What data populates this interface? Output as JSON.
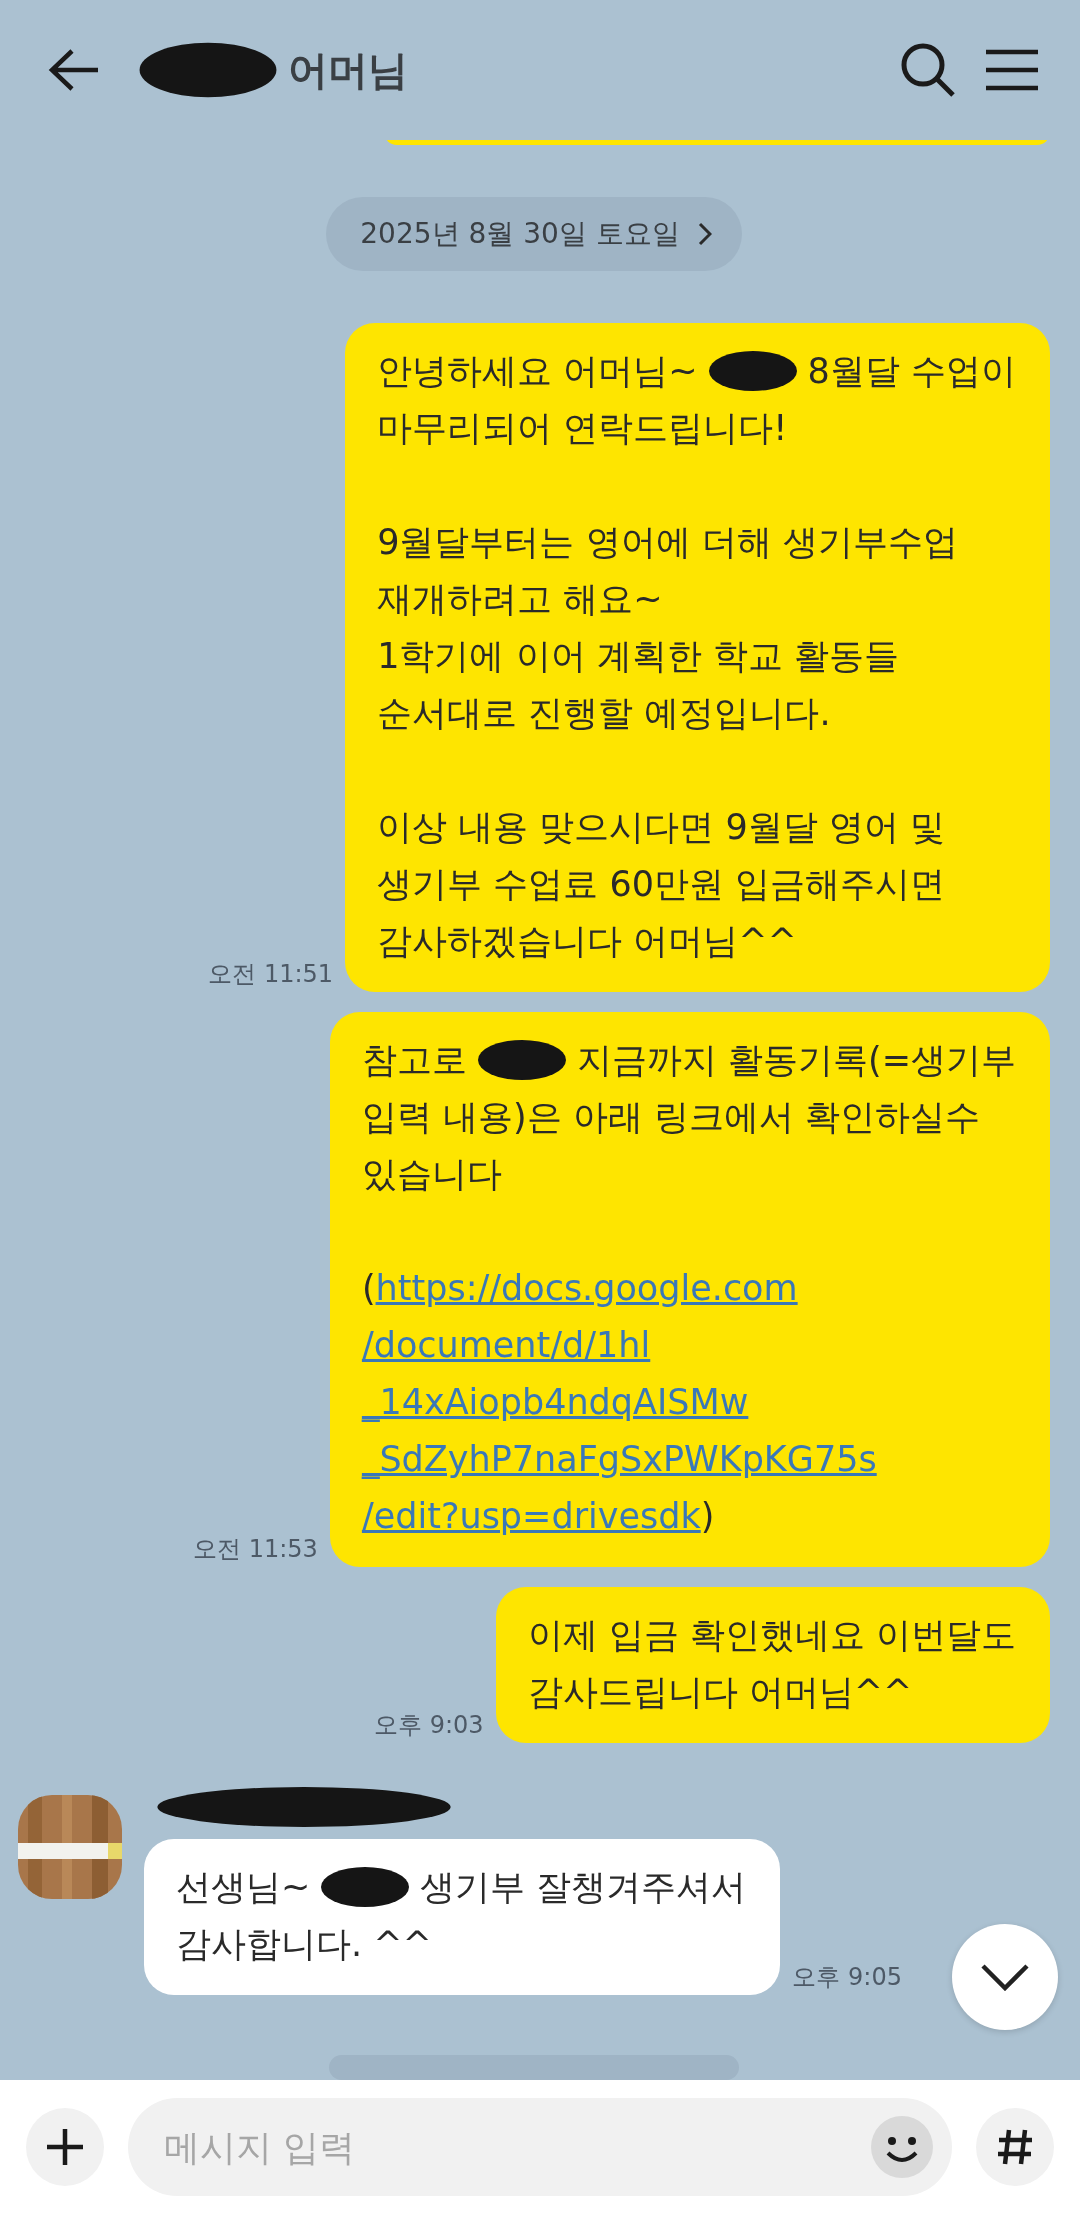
{
  "header": {
    "title": [
      {
        "kind": "redaction"
      },
      {
        "kind": "text",
        "text": "어머님"
      }
    ]
  },
  "date_divider": {
    "label": "2025년 8월 30일 토요일"
  },
  "messages": [
    {
      "kind": "sent",
      "time": "오전 11:51",
      "paragraphs": [
        [
          [
            {
              "kind": "text",
              "text": "안녕하세요 어머님~"
            },
            {
              "kind": "redaction"
            },
            {
              "kind": "text",
              "text": "8월달 수업이"
            }
          ],
          [
            {
              "kind": "text",
              "text": "마무리되어 연락드립니다!"
            }
          ]
        ],
        [
          [
            {
              "kind": "text",
              "text": "9월달부터는 영어에 더해 생기부수업"
            }
          ],
          [
            {
              "kind": "text",
              "text": "재개하려고 해요~"
            }
          ],
          [
            {
              "kind": "text",
              "text": "1학기에 이어 계획한 학교 활동들"
            }
          ],
          [
            {
              "kind": "text",
              "text": "순서대로 진행할 예정입니다."
            }
          ]
        ],
        [
          [
            {
              "kind": "text",
              "text": "이상 내용 맞으시다면 9월달 영어 및"
            }
          ],
          [
            {
              "kind": "text",
              "text": "생기부 수업료 60만원 입금해주시면"
            }
          ],
          [
            {
              "kind": "text",
              "text": "감사하겠습니다 어머님^^"
            }
          ]
        ]
      ]
    },
    {
      "kind": "sent",
      "time": "오전 11:53",
      "paragraphs": [
        [
          [
            {
              "kind": "text",
              "text": "참고로"
            },
            {
              "kind": "redaction"
            },
            {
              "kind": "text",
              "text": "지금까지 활동기록(=생기부"
            }
          ],
          [
            {
              "kind": "text",
              "text": "입력 내용)은 아래 링크에서 확인하실수"
            }
          ],
          [
            {
              "kind": "text",
              "text": "있습니다"
            }
          ]
        ],
        [
          [
            {
              "kind": "text",
              "text": "("
            },
            {
              "kind": "link",
              "text": "https://docs.google.com"
            }
          ],
          [
            {
              "kind": "link",
              "text": "/document/d/1hl"
            }
          ],
          [
            {
              "kind": "link",
              "text": "_14xAiopb4ndqAISMw"
            }
          ],
          [
            {
              "kind": "link",
              "text": "_SdZyhP7naFgSxPWKpKG75s"
            }
          ],
          [
            {
              "kind": "link",
              "text": "/edit?usp=drivesdk"
            },
            {
              "kind": "text",
              "text": ")"
            }
          ]
        ]
      ]
    },
    {
      "kind": "sent",
      "time": "오후 9:03",
      "paragraphs": [
        [
          [
            {
              "kind": "text",
              "text": "이제 입금 확인했네요 이번달도"
            }
          ],
          [
            {
              "kind": "text",
              "text": "감사드립니다 어머님^^"
            }
          ]
        ]
      ]
    },
    {
      "kind": "received",
      "time": "오후 9:05",
      "name_hidden": true,
      "paragraphs": [
        [
          [
            {
              "kind": "text",
              "text": "선생님~"
            },
            {
              "kind": "redaction"
            },
            {
              "kind": "text",
              "text": "생기부 잘챙겨주셔서"
            }
          ],
          [
            {
              "kind": "text",
              "text": "감사합니다. ^^"
            }
          ]
        ]
      ]
    }
  ],
  "composer": {
    "placeholder": "메시지 입력"
  }
}
